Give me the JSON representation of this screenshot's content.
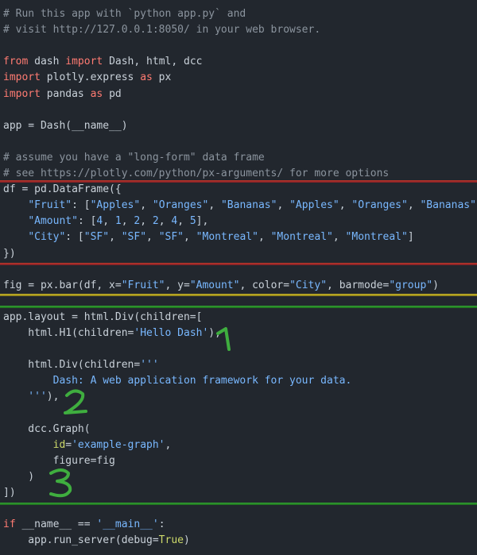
{
  "code": {
    "lines": [
      [
        {
          "t": "c",
          "v": "# Run this app with `python app.py` and"
        }
      ],
      [
        {
          "t": "c",
          "v": "# visit http://127.0.0.1:8050/ in your web browser."
        }
      ],
      [],
      [
        {
          "t": "k",
          "v": "from"
        },
        {
          "t": "p",
          "v": " dash "
        },
        {
          "t": "k",
          "v": "import"
        },
        {
          "t": "p",
          "v": " Dash, html, dcc"
        }
      ],
      [
        {
          "t": "k",
          "v": "import"
        },
        {
          "t": "p",
          "v": " plotly.express "
        },
        {
          "t": "k",
          "v": "as"
        },
        {
          "t": "p",
          "v": " px"
        }
      ],
      [
        {
          "t": "k",
          "v": "import"
        },
        {
          "t": "p",
          "v": " pandas "
        },
        {
          "t": "k",
          "v": "as"
        },
        {
          "t": "p",
          "v": " pd"
        }
      ],
      [],
      [
        {
          "t": "p",
          "v": "app = Dash(__name__)"
        }
      ],
      [],
      [
        {
          "t": "c",
          "v": "# assume you have a \"long-form\" data frame"
        }
      ],
      [
        {
          "t": "c",
          "v": "# see https://plotly.com/python/px-arguments/ for more options"
        }
      ],
      [
        {
          "t": "p",
          "v": "df = pd.DataFrame({"
        }
      ],
      [
        {
          "t": "p",
          "v": "    "
        },
        {
          "t": "s",
          "v": "\"Fruit\""
        },
        {
          "t": "p",
          "v": ": ["
        },
        {
          "t": "s",
          "v": "\"Apples\""
        },
        {
          "t": "p",
          "v": ", "
        },
        {
          "t": "s",
          "v": "\"Oranges\""
        },
        {
          "t": "p",
          "v": ", "
        },
        {
          "t": "s",
          "v": "\"Bananas\""
        },
        {
          "t": "p",
          "v": ", "
        },
        {
          "t": "s",
          "v": "\"Apples\""
        },
        {
          "t": "p",
          "v": ", "
        },
        {
          "t": "s",
          "v": "\"Oranges\""
        },
        {
          "t": "p",
          "v": ", "
        },
        {
          "t": "s",
          "v": "\"Bananas\""
        },
        {
          "t": "p",
          "v": "],"
        }
      ],
      [
        {
          "t": "p",
          "v": "    "
        },
        {
          "t": "s",
          "v": "\"Amount\""
        },
        {
          "t": "p",
          "v": ": ["
        },
        {
          "t": "n",
          "v": "4"
        },
        {
          "t": "p",
          "v": ", "
        },
        {
          "t": "n",
          "v": "1"
        },
        {
          "t": "p",
          "v": ", "
        },
        {
          "t": "n",
          "v": "2"
        },
        {
          "t": "p",
          "v": ", "
        },
        {
          "t": "n",
          "v": "2"
        },
        {
          "t": "p",
          "v": ", "
        },
        {
          "t": "n",
          "v": "4"
        },
        {
          "t": "p",
          "v": ", "
        },
        {
          "t": "n",
          "v": "5"
        },
        {
          "t": "p",
          "v": "],"
        }
      ],
      [
        {
          "t": "p",
          "v": "    "
        },
        {
          "t": "s",
          "v": "\"City\""
        },
        {
          "t": "p",
          "v": ": ["
        },
        {
          "t": "s",
          "v": "\"SF\""
        },
        {
          "t": "p",
          "v": ", "
        },
        {
          "t": "s",
          "v": "\"SF\""
        },
        {
          "t": "p",
          "v": ", "
        },
        {
          "t": "s",
          "v": "\"SF\""
        },
        {
          "t": "p",
          "v": ", "
        },
        {
          "t": "s",
          "v": "\"Montreal\""
        },
        {
          "t": "p",
          "v": ", "
        },
        {
          "t": "s",
          "v": "\"Montreal\""
        },
        {
          "t": "p",
          "v": ", "
        },
        {
          "t": "s",
          "v": "\"Montreal\""
        },
        {
          "t": "p",
          "v": "]"
        }
      ],
      [
        {
          "t": "p",
          "v": "})"
        }
      ],
      [],
      [
        {
          "t": "p",
          "v": "fig = px.bar(df, x="
        },
        {
          "t": "s",
          "v": "\"Fruit\""
        },
        {
          "t": "p",
          "v": ", y="
        },
        {
          "t": "s",
          "v": "\"Amount\""
        },
        {
          "t": "p",
          "v": ", color="
        },
        {
          "t": "s",
          "v": "\"City\""
        },
        {
          "t": "p",
          "v": ", barmode="
        },
        {
          "t": "s",
          "v": "\"group\""
        },
        {
          "t": "p",
          "v": ")"
        }
      ],
      [],
      [
        {
          "t": "p",
          "v": "app.layout = html.Div(children=["
        }
      ],
      [
        {
          "t": "p",
          "v": "    html.H1(children="
        },
        {
          "t": "s",
          "v": "'Hello Dash'"
        },
        {
          "t": "p",
          "v": "),"
        }
      ],
      [],
      [
        {
          "t": "p",
          "v": "    html.Div(children="
        },
        {
          "t": "s",
          "v": "'''"
        }
      ],
      [
        {
          "t": "s",
          "v": "        Dash: A web application framework for your data."
        }
      ],
      [
        {
          "t": "s",
          "v": "    '''"
        },
        {
          "t": "p",
          "v": "),"
        }
      ],
      [],
      [
        {
          "t": "p",
          "v": "    dcc.Graph("
        }
      ],
      [
        {
          "t": "p",
          "v": "        "
        },
        {
          "t": "g",
          "v": "id"
        },
        {
          "t": "p",
          "v": "="
        },
        {
          "t": "s",
          "v": "'example-graph'"
        },
        {
          "t": "p",
          "v": ","
        }
      ],
      [
        {
          "t": "p",
          "v": "        figure=fig"
        }
      ],
      [
        {
          "t": "p",
          "v": "    )"
        }
      ],
      [
        {
          "t": "p",
          "v": "])"
        }
      ],
      [],
      [
        {
          "t": "k",
          "v": "if"
        },
        {
          "t": "p",
          "v": " __name__ == "
        },
        {
          "t": "s",
          "v": "'__main__'"
        },
        {
          "t": "p",
          "v": ":"
        }
      ],
      [
        {
          "t": "p",
          "v": "    app.run_server(debug="
        },
        {
          "t": "g",
          "v": "True"
        },
        {
          "t": "p",
          "v": ")"
        }
      ]
    ]
  },
  "annotations": [
    {
      "label": "1"
    },
    {
      "label": "2"
    },
    {
      "label": "3"
    }
  ],
  "colors": {
    "background": "#22272e",
    "comment": "#8b949e",
    "keyword": "#ff7b72",
    "string": "#79b8ff",
    "separator_red": "#b3263a",
    "separator_yellow": "#b8a822",
    "separator_green": "#2f9e2f",
    "annotation_green": "#3fae3f"
  }
}
